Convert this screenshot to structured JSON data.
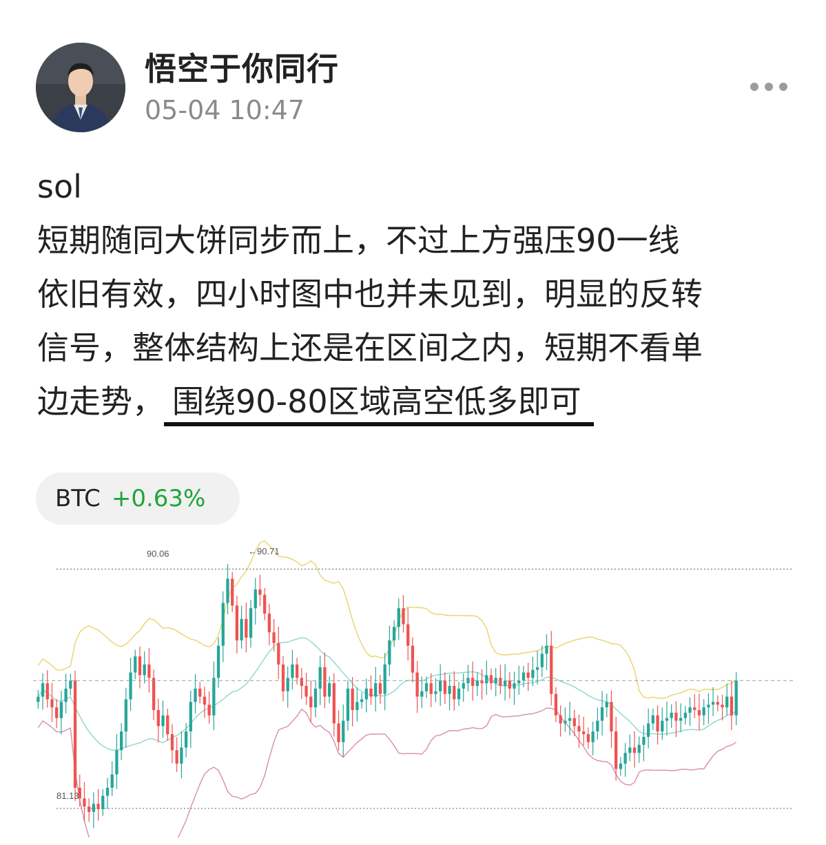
{
  "author": {
    "name": "悟空于你同行",
    "time": "05-04 10:47"
  },
  "post": {
    "lines": [
      "sol",
      "短期随同大饼同步而上，不过上方强压90一线",
      "依旧有效，四小时图中也并未见到，明显的反转",
      "信号，整体结构上还是在区间之内，短期不看单"
    ],
    "last_plain": "边走势，",
    "last_highlight": "围绕90-80区域高空低多即可"
  },
  "ticker": {
    "symbol": "BTC",
    "change": "+0.63%"
  },
  "colors": {
    "up": "#26a69a",
    "down": "#ef5350",
    "upper_band": "#e8d46a",
    "mid_band": "#8fd6c8",
    "lower_band": "#d98cb0",
    "ticker_green": "#1fa53b"
  },
  "chart_data": {
    "type": "candlestick",
    "levels": [
      {
        "label": "90.06",
        "value": 90.06
      },
      {
        "label": "81.13",
        "value": 81.13
      }
    ],
    "annotation": {
      "label": "←90.71",
      "value": 90.71
    },
    "ylim": [
      80.2,
      91.2
    ],
    "close": [
      85.3,
      85.8,
      85.2,
      84.9,
      84.5,
      85.1,
      85.6,
      85.9,
      81.9,
      81.5,
      81.2,
      81.0,
      81.3,
      81.1,
      81.6,
      81.9,
      82.4,
      83.3,
      84.0,
      85.2,
      86.2,
      86.8,
      86.1,
      86.5,
      86.0,
      84.8,
      84.2,
      84.6,
      83.9,
      83.3,
      82.8,
      83.4,
      84.0,
      85.1,
      85.6,
      85.3,
      85.0,
      84.6,
      86.0,
      87.2,
      88.8,
      89.7,
      88.7,
      87.4,
      88.2,
      87.5,
      88.6,
      89.3,
      89.1,
      88.4,
      87.7,
      87.3,
      86.5,
      85.5,
      86.0,
      86.5,
      86.0,
      85.7,
      85.3,
      84.9,
      85.6,
      86.4,
      85.3,
      85.8,
      84.3,
      83.6,
      84.4,
      85.6,
      84.8,
      85.1,
      85.2,
      85.6,
      85.3,
      85.8,
      85.4,
      86.5,
      87.4,
      87.9,
      88.6,
      88.0,
      87.2,
      86.2,
      85.3,
      85.5,
      85.8,
      85.4,
      85.5,
      85.9,
      85.4,
      85.7,
      85.2,
      85.6,
      85.8,
      86.0,
      85.7,
      85.9,
      85.8,
      86.1,
      85.8,
      86.0,
      85.7,
      85.9,
      85.6,
      85.8,
      85.9,
      86.2,
      86.0,
      86.3,
      86.4,
      86.9,
      87.2,
      85.4,
      84.6,
      84.3,
      84.4,
      84.5,
      84.2,
      84.0,
      83.9,
      83.6,
      84.0,
      84.4,
      84.9,
      85.1,
      84.0,
      82.6,
      82.8,
      83.2,
      83.4,
      83.2,
      83.5,
      83.8,
      84.3,
      84.6,
      84.0,
      84.4,
      84.5,
      84.7,
      84.4,
      84.5,
      84.7,
      84.9,
      84.8,
      84.6,
      84.9,
      85.0,
      85.1,
      85.0,
      84.9,
      85.3,
      84.6,
      85.9
    ]
  }
}
